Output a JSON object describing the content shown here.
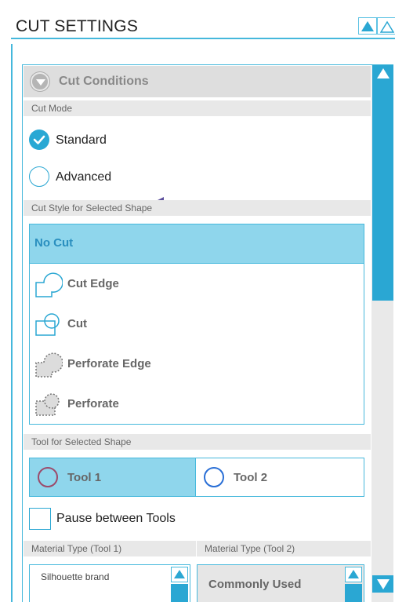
{
  "header": {
    "title": "CUT SETTINGS"
  },
  "section": {
    "title": "Cut Conditions"
  },
  "cut_mode": {
    "label": "Cut Mode",
    "options": [
      {
        "label": "Standard",
        "selected": true
      },
      {
        "label": "Advanced",
        "selected": false
      }
    ]
  },
  "cut_style": {
    "label": "Cut Style for Selected Shape",
    "items": [
      {
        "label": "No Cut",
        "icon": "no-cut",
        "selected": true
      },
      {
        "label": "Cut Edge",
        "icon": "cut-edge-icon",
        "selected": false
      },
      {
        "label": "Cut",
        "icon": "cut-icon",
        "selected": false
      },
      {
        "label": "Perforate Edge",
        "icon": "perforate-edge-icon",
        "selected": false
      },
      {
        "label": "Perforate",
        "icon": "perforate-icon",
        "selected": false
      }
    ]
  },
  "tool": {
    "label": "Tool for Selected Shape",
    "options": [
      {
        "label": "Tool 1",
        "ring_color": "#9c4a6a",
        "selected": true
      },
      {
        "label": "Tool 2",
        "ring_color": "#2a6fd6",
        "selected": false
      }
    ],
    "pause_label": "Pause between Tools",
    "pause_checked": false
  },
  "material": {
    "tool1_label": "Material Type (Tool 1)",
    "tool2_label": "Material Type (Tool 2)",
    "tool1_value": "Silhouette brand",
    "tool2_value": "Commonly Used"
  },
  "colors": {
    "accent": "#2aa7d3",
    "selected_fill": "#8fd6ec",
    "arrow": "#5b4e9c"
  }
}
